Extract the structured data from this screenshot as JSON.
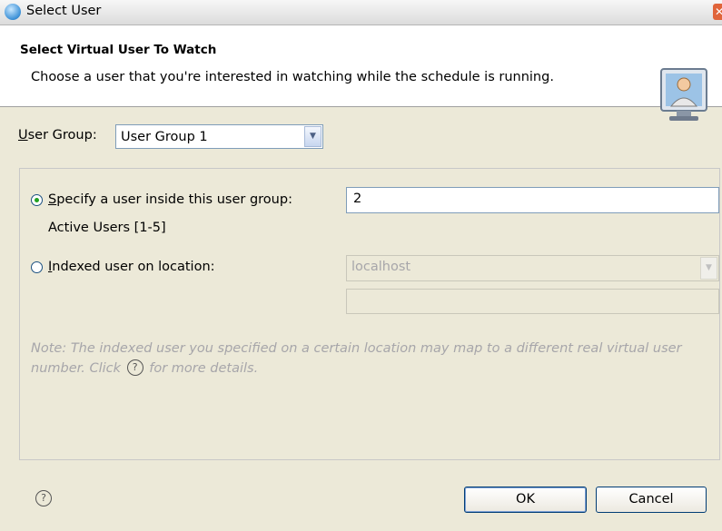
{
  "window": {
    "title": "Select User"
  },
  "banner": {
    "title": "Select Virtual User To Watch",
    "description": "Choose a user that you're interested in watching while the schedule is running.",
    "icon": "user-monitor-icon"
  },
  "user_group": {
    "label": "User Group:",
    "selected": "User Group 1"
  },
  "options": {
    "specify": {
      "label": "Specify a user inside this user group:",
      "value": "2",
      "checked": true,
      "active_users": "Active Users [1-5]"
    },
    "indexed": {
      "label": "Indexed user on location:",
      "location": "localhost",
      "index_value": "",
      "checked": false
    }
  },
  "note": {
    "part1": "Note: The indexed user you specified on a certain location may map to a different real virtual user number.  Click ",
    "part2": " for more details."
  },
  "buttons": {
    "ok": "OK",
    "cancel": "Cancel"
  },
  "colors": {
    "accent_radio": "#21a121",
    "disabled_text": "#a7a6aa"
  }
}
